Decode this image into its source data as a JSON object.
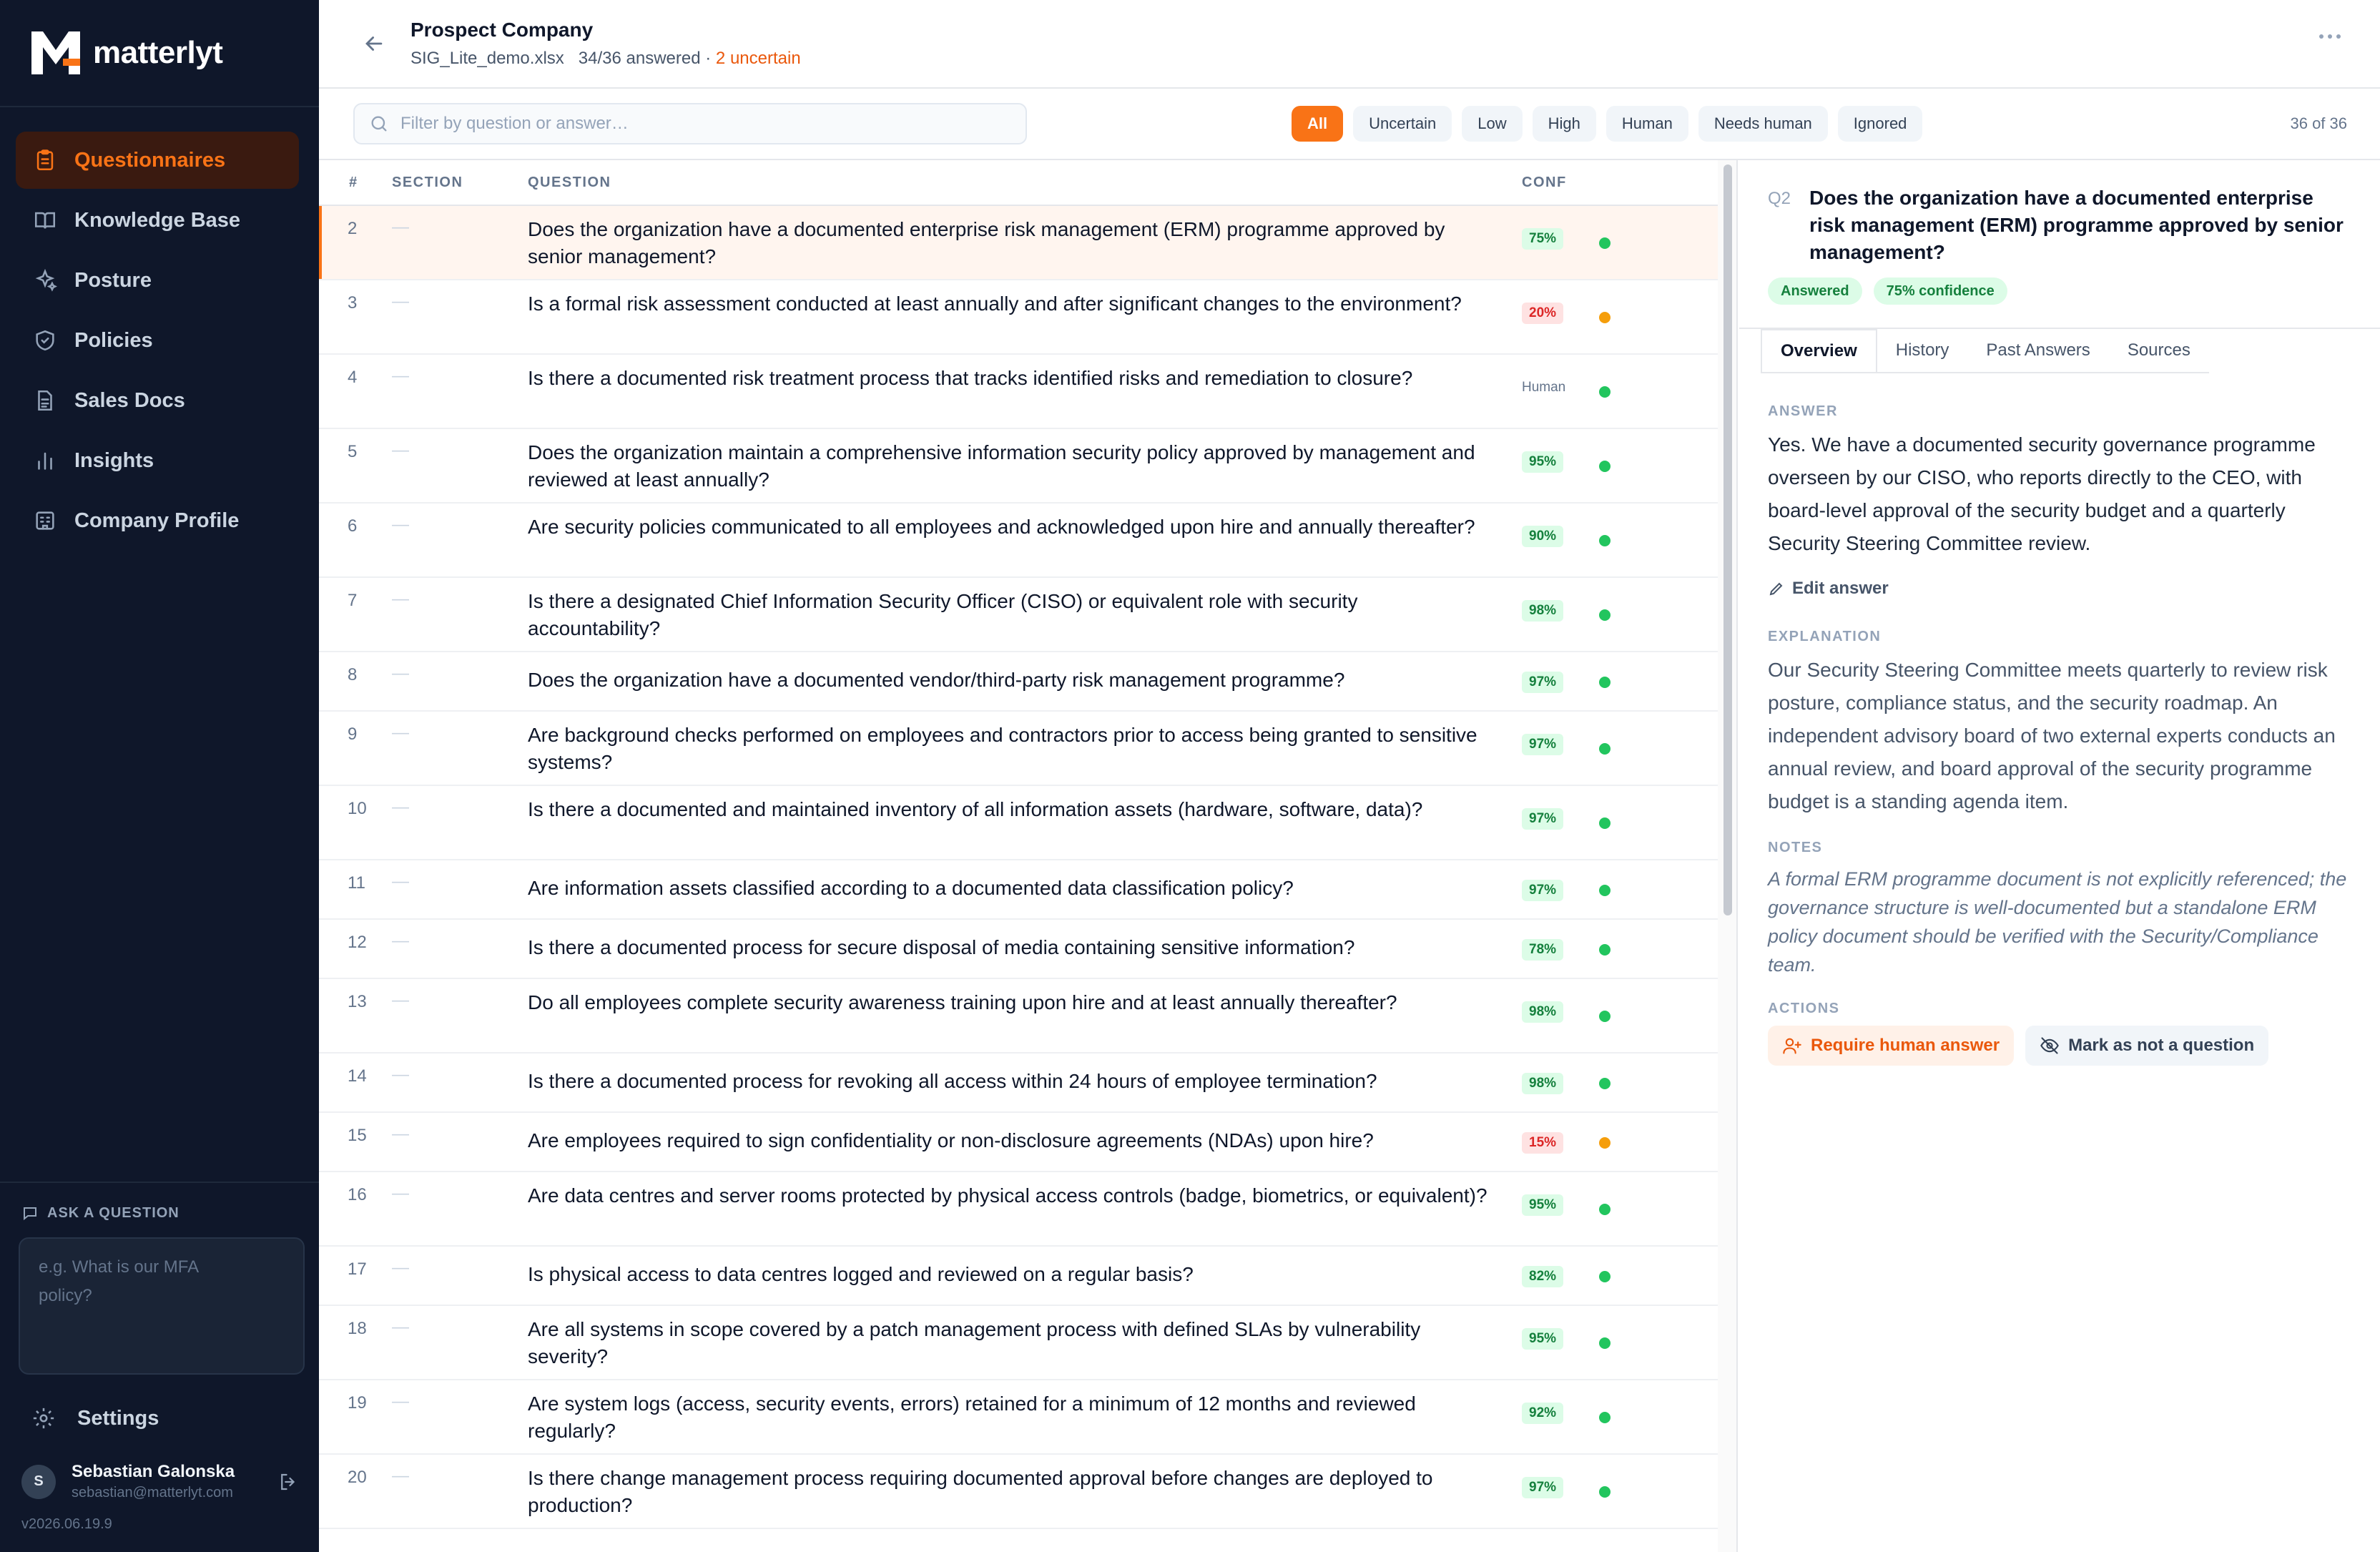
{
  "brand": {
    "name": "matterlyt",
    "logo_icon": "matterlyt-logo-icon",
    "accent": "#f97316"
  },
  "nav": [
    {
      "label": "Questionnaires",
      "icon": "clipboard-icon",
      "active": true
    },
    {
      "label": "Knowledge Base",
      "icon": "book-icon",
      "active": false
    },
    {
      "label": "Posture",
      "icon": "sparkles-icon",
      "active": false
    },
    {
      "label": "Policies",
      "icon": "shield-icon",
      "active": false
    },
    {
      "label": "Sales Docs",
      "icon": "document-icon",
      "active": false
    },
    {
      "label": "Insights",
      "icon": "bar-chart-icon",
      "active": false
    },
    {
      "label": "Company Profile",
      "icon": "building-icon",
      "active": false
    }
  ],
  "ask": {
    "label": "ASK A QUESTION",
    "placeholder": "e.g. What is our MFA\npolicy?"
  },
  "settings_label": "Settings",
  "user": {
    "initial": "S",
    "name": "Sebastian Galonska",
    "email": "sebastian@matterlyt.com"
  },
  "version": "v2026.06.19.9",
  "header": {
    "title": "Prospect Company",
    "file": "SIG_Lite_demo.xlsx",
    "answered": "34/36 answered ·",
    "uncertain": "2 uncertain"
  },
  "filters": {
    "placeholder": "Filter by question or answer…",
    "chips": [
      "All",
      "Uncertain",
      "Low",
      "High",
      "Human",
      "Needs human",
      "Ignored"
    ],
    "active": "All",
    "count": "36 of 36"
  },
  "table": {
    "headers": {
      "num": "#",
      "section": "SECTION",
      "question": "QUESTION",
      "conf": "CONF"
    },
    "rows": [
      {
        "num": "2",
        "section": "—",
        "question": "Does the organization have a documented enterprise risk management (ERM) programme approved by senior management?",
        "conf": "75%",
        "conf_type": "green",
        "status": "green",
        "selected": true
      },
      {
        "num": "3",
        "section": "—",
        "question": "Is a formal risk assessment conducted at least annually and after significant changes to the environment?",
        "conf": "20%",
        "conf_type": "red",
        "status": "orange"
      },
      {
        "num": "4",
        "section": "—",
        "question": "Is there a documented risk treatment process that tracks identified risks and remediation to closure?",
        "conf": "Human",
        "conf_type": "human",
        "status": "green"
      },
      {
        "num": "5",
        "section": "—",
        "question": "Does the organization maintain a comprehensive information security policy approved by management and reviewed at least annually?",
        "conf": "95%",
        "conf_type": "green",
        "status": "green"
      },
      {
        "num": "6",
        "section": "—",
        "question": "Are security policies communicated to all employees and acknowledged upon hire and annually thereafter?",
        "conf": "90%",
        "conf_type": "green",
        "status": "green"
      },
      {
        "num": "7",
        "section": "—",
        "question": "Is there a designated Chief Information Security Officer (CISO) or equivalent role with security accountability?",
        "conf": "98%",
        "conf_type": "green",
        "status": "green"
      },
      {
        "num": "8",
        "section": "—",
        "question": "Does the organization have a documented vendor/third-party risk management programme?",
        "conf": "97%",
        "conf_type": "green",
        "status": "green"
      },
      {
        "num": "9",
        "section": "—",
        "question": "Are background checks performed on employees and contractors prior to access being granted to sensitive systems?",
        "conf": "97%",
        "conf_type": "green",
        "status": "green"
      },
      {
        "num": "10",
        "section": "—",
        "question": "Is there a documented and maintained inventory of all information assets (hardware, software, data)?",
        "conf": "97%",
        "conf_type": "green",
        "status": "green"
      },
      {
        "num": "11",
        "section": "—",
        "question": "Are information assets classified according to a documented data classification policy?",
        "conf": "97%",
        "conf_type": "green",
        "status": "green"
      },
      {
        "num": "12",
        "section": "—",
        "question": "Is there a documented process for secure disposal of media containing sensitive information?",
        "conf": "78%",
        "conf_type": "green",
        "status": "green"
      },
      {
        "num": "13",
        "section": "—",
        "question": "Do all employees complete security awareness training upon hire and at least annually thereafter?",
        "conf": "98%",
        "conf_type": "green",
        "status": "green"
      },
      {
        "num": "14",
        "section": "—",
        "question": "Is there a documented process for revoking all access within 24 hours of employee termination?",
        "conf": "98%",
        "conf_type": "green",
        "status": "green"
      },
      {
        "num": "15",
        "section": "—",
        "question": "Are employees required to sign confidentiality or non-disclosure agreements (NDAs) upon hire?",
        "conf": "15%",
        "conf_type": "red",
        "status": "orange"
      },
      {
        "num": "16",
        "section": "—",
        "question": "Are data centres and server rooms protected by physical access controls (badge, biometrics, or equivalent)?",
        "conf": "95%",
        "conf_type": "green",
        "status": "green"
      },
      {
        "num": "17",
        "section": "—",
        "question": "Is physical access to data centres logged and reviewed on a regular basis?",
        "conf": "82%",
        "conf_type": "green",
        "status": "green"
      },
      {
        "num": "18",
        "section": "—",
        "question": "Are all systems in scope covered by a patch management process with defined SLAs by vulnerability severity?",
        "conf": "95%",
        "conf_type": "green",
        "status": "green"
      },
      {
        "num": "19",
        "section": "—",
        "question": "Are system logs (access, security events, errors) retained for a minimum of 12 months and reviewed regularly?",
        "conf": "92%",
        "conf_type": "green",
        "status": "green"
      },
      {
        "num": "20",
        "section": "—",
        "question": "Is there change management process requiring documented approval before changes are deployed to production?",
        "conf": "97%",
        "conf_type": "green",
        "status": "green"
      }
    ]
  },
  "detail": {
    "qnum": "Q2",
    "question": "Does the organization have a documented enterprise risk management (ERM) programme approved by senior management?",
    "status_badge": "Answered",
    "confidence_badge": "75% confidence",
    "tabs": [
      "Overview",
      "History",
      "Past Answers",
      "Sources"
    ],
    "active_tab": "Overview",
    "answer_label": "ANSWER",
    "answer": "Yes. We have a documented security governance programme overseen by our CISO, who reports directly to the CEO, with board-level approval of the security budget and a quarterly Security Steering Committee review.",
    "edit_label": "Edit answer",
    "explanation_label": "EXPLANATION",
    "explanation": "Our Security Steering Committee meets quarterly to review risk posture, compliance status, and the security roadmap. An independent advisory board of two external experts conducts an annual review, and board approval of the security programme budget is a standing agenda item.",
    "notes_label": "NOTES",
    "notes": "A formal ERM programme document is not explicitly referenced; the governance structure is well-documented but a standalone ERM policy document should be verified with the Security/Compliance team.",
    "actions_label": "ACTIONS",
    "require_human": "Require human answer",
    "mark_not_question": "Mark as not a question"
  },
  "colors": {
    "sidebar_bg": "#0f172a",
    "accent": "#f97316",
    "uncertain": "#ea580c",
    "success": "#22c55e",
    "warning": "#f59e0b",
    "danger": "#dc2626"
  }
}
